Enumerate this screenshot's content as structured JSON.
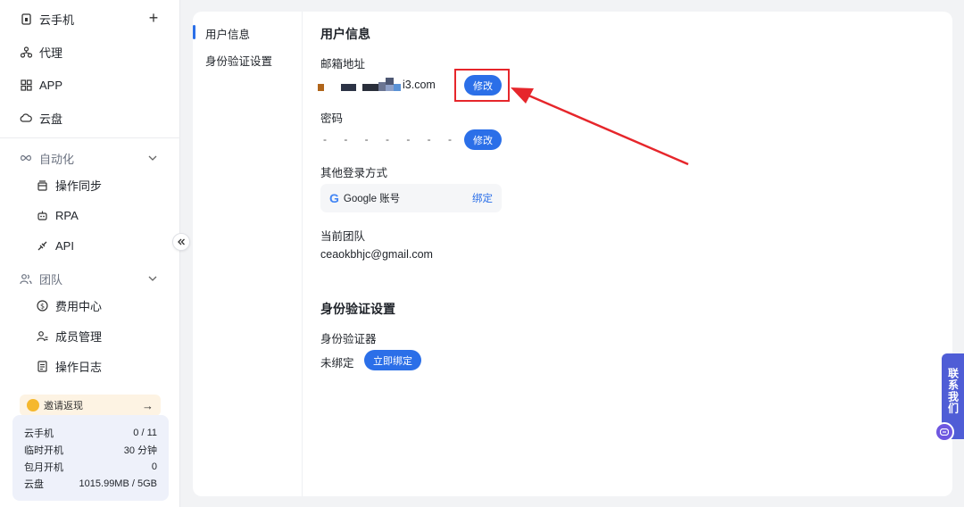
{
  "sidebar": {
    "items": [
      {
        "label": "云手机",
        "icon": "phone-icon"
      },
      {
        "label": "代理",
        "icon": "proxy-icon"
      },
      {
        "label": "APP",
        "icon": "grid-icon"
      },
      {
        "label": "云盘",
        "icon": "cloud-icon"
      }
    ],
    "automation": {
      "label": "自动化",
      "children": [
        {
          "label": "操作同步",
          "icon": "sync-icon"
        },
        {
          "label": "RPA",
          "icon": "robot-icon"
        },
        {
          "label": "API",
          "icon": "plug-icon"
        }
      ]
    },
    "team": {
      "label": "团队",
      "children": [
        {
          "label": "费用中心",
          "icon": "dollar-icon"
        },
        {
          "label": "成员管理",
          "icon": "member-icon"
        },
        {
          "label": "操作日志",
          "icon": "log-icon"
        }
      ]
    },
    "invite": {
      "label": "邀请返现",
      "arrow": "→"
    },
    "stats": [
      {
        "label": "云手机",
        "value": "0 / 11"
      },
      {
        "label": "临时开机",
        "value": "30 分钟"
      },
      {
        "label": "包月开机",
        "value": "0"
      },
      {
        "label": "云盘",
        "value": "1015.99MB / 5GB"
      }
    ]
  },
  "subnav": [
    {
      "label": "用户信息"
    },
    {
      "label": "身份验证设置"
    }
  ],
  "user_info": {
    "title": "用户信息",
    "email_label": "邮箱地址",
    "email_suffix": "i3.com",
    "edit_email": "修改",
    "password_label": "密码",
    "password_mask": "- - - - - - - - -",
    "edit_password": "修改",
    "other_login_label": "其他登录方式",
    "google_label": "Google 账号",
    "google_bind": "绑定",
    "team_label": "当前团队",
    "team_value": "ceaokbhjc@gmail.com"
  },
  "auth": {
    "title": "身份验证设置",
    "authenticator_label": "身份验证器",
    "status": "未绑定",
    "bind_now": "立即绑定"
  },
  "contact": {
    "label": "联系我们"
  },
  "colors": {
    "accent": "#2b6fe8",
    "highlight": "#e6262b"
  }
}
